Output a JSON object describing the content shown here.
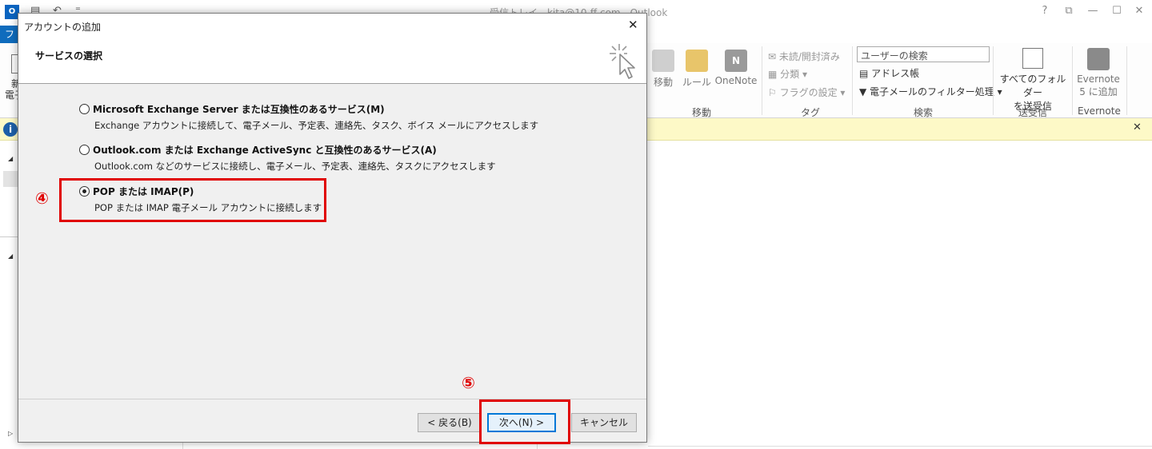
{
  "window": {
    "title": "受信トレイ - kita@10-ff.com - Outlook",
    "logo": "O",
    "controls": [
      "?",
      "⧉",
      "—",
      "☐",
      "✕"
    ]
  },
  "ribbon": {
    "file_tab": "ファイル",
    "new_line1": "新",
    "new_line2": "電子",
    "move_label": "移動",
    "rules_label": "ルール",
    "onenote_label": "OneNote",
    "group_move": "移動",
    "unread_label": "未読/開封済み",
    "categorize_label": "分類",
    "flag_label": "フラグの設定",
    "group_tags": "タグ",
    "search_placeholder": "ユーザーの検索",
    "address_book_label": "アドレス帳",
    "filter_label": "電子メールのフィルター処理",
    "group_find": "検索",
    "send_receive_all_line1": "すべてのフォルダー",
    "send_receive_all_line2": "を送受信",
    "group_send_receive": "送受信",
    "evernote_line1": "Evernote",
    "evernote_line2": "5 に追加",
    "group_evernote": "Evernote"
  },
  "infobar": {
    "icon": "i",
    "close": "✕"
  },
  "dialog": {
    "title": "アカウントの追加",
    "close": "✕",
    "subtitle": "サービスの選択",
    "options": [
      {
        "label": "Microsoft Exchange Server または互換性のあるサービス(M)",
        "description": "Exchange アカウントに接続して、電子メール、予定表、連絡先、タスク、ボイス メールにアクセスします",
        "selected": false
      },
      {
        "label": "Outlook.com または Exchange ActiveSync と互換性のあるサービス(A)",
        "description": "Outlook.com などのサービスに接続し、電子メール、予定表、連絡先、タスクにアクセスします",
        "selected": false
      },
      {
        "label": "POP または IMAP(P)",
        "description": "POP または IMAP 電子メール アカウントに接続します",
        "selected": true
      }
    ],
    "buttons": {
      "back": "< 戻る(B)",
      "next": "次へ(N) >",
      "cancel": "キャンセル"
    }
  },
  "annotations": {
    "step4": "④",
    "step5": "⑤",
    "highlight_color": "#e00000"
  }
}
